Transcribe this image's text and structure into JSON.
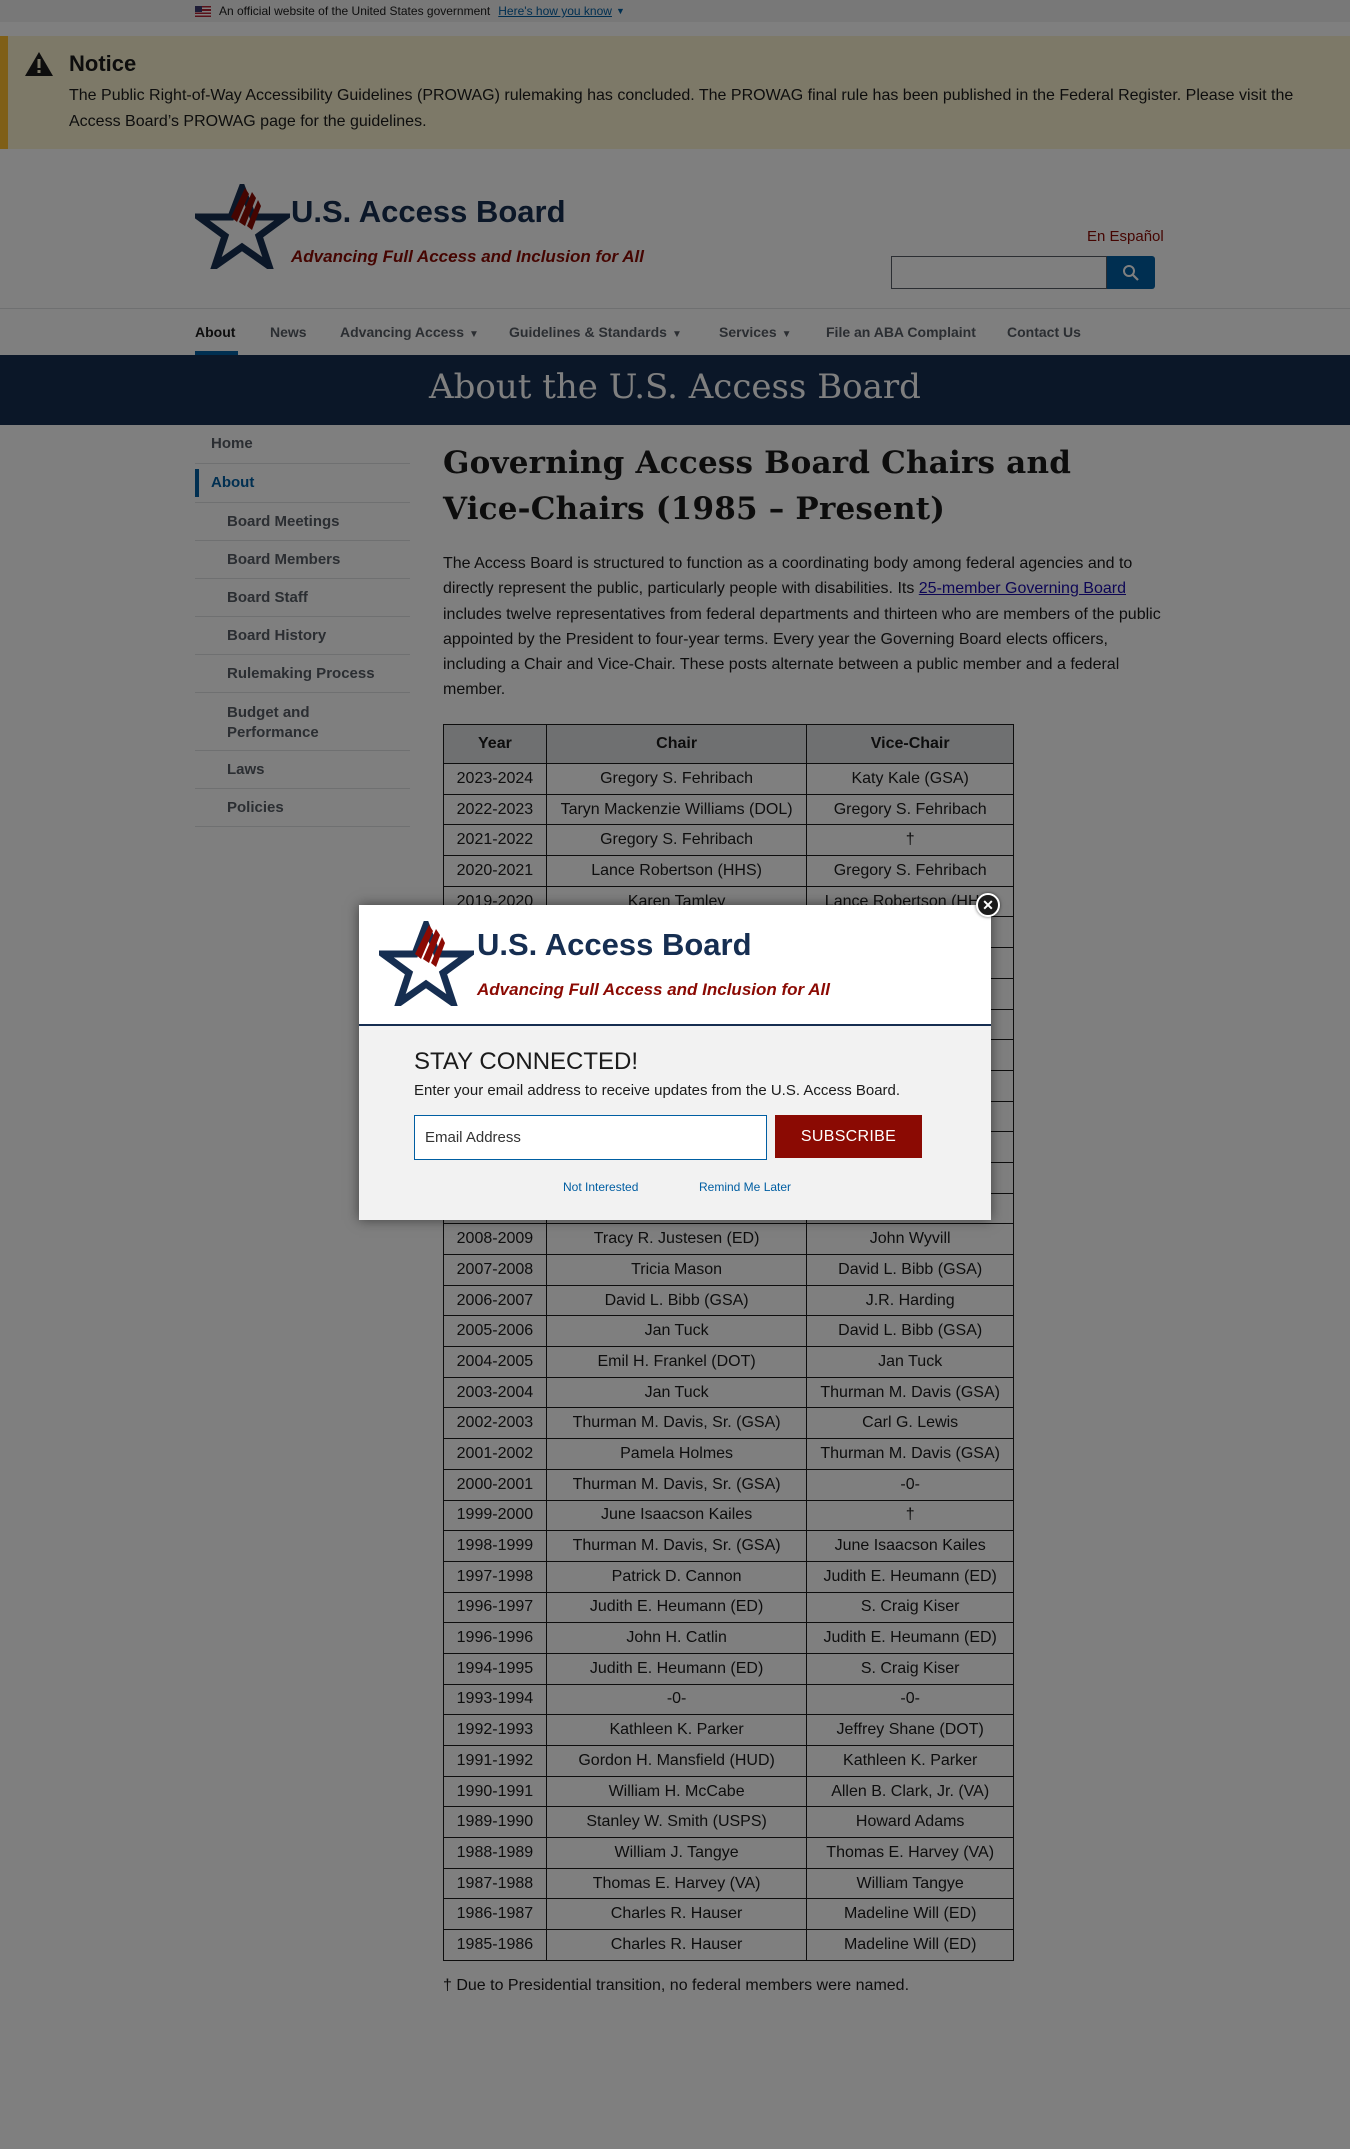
{
  "gov_banner": {
    "text": "An official website of the United States government",
    "link": "Here's how you know"
  },
  "notice": {
    "title": "Notice",
    "body": "The Public Right-of-Way Accessibility Guidelines (PROWAG) rulemaking has concluded. The PROWAG final rule has been published in the Federal Register. Please visit the Access Board’s PROWAG page for the guidelines."
  },
  "header": {
    "site_title": "U.S. Access Board",
    "tagline": "Advancing Full Access and Inclusion for All",
    "language_link": "En Español",
    "search_value": ""
  },
  "nav": {
    "items": [
      {
        "label": "About",
        "active": true
      },
      {
        "label": "News"
      },
      {
        "label": "Advancing Access",
        "dropdown": true
      },
      {
        "label": "Guidelines & Standards",
        "dropdown": true
      },
      {
        "label": "Services",
        "dropdown": true
      },
      {
        "label": "File an ABA Complaint"
      },
      {
        "label": "Contact Us"
      }
    ]
  },
  "hero": {
    "title": "About the U.S. Access Board"
  },
  "sidebar": {
    "items": [
      {
        "label": "Home"
      },
      {
        "label": "About",
        "current": true
      },
      {
        "label": "Board Meetings"
      },
      {
        "label": "Board Members"
      },
      {
        "label": "Board Staff"
      },
      {
        "label": "Board History"
      },
      {
        "label": "Rulemaking Process"
      },
      {
        "label": "Budget and Performance"
      },
      {
        "label": "Laws"
      },
      {
        "label": "Policies"
      }
    ]
  },
  "main": {
    "heading": "Governing Access Board Chairs and Vice-Chairs (1985 – Present)",
    "intro_before": "The Access Board is structured to function as a coordinating body among federal agencies and to directly represent the public, particularly people with disabilities. Its ",
    "intro_link": "25-member Governing Board",
    "intro_after": " includes twelve representatives from federal departments and thirteen who are members of the public appointed by the President to four-year terms. Every year the Governing Board elects officers, including a Chair and Vice-Chair. These posts alternate between a public member and a federal member.",
    "table": {
      "headers": [
        "Year",
        "Chair",
        "Vice-Chair"
      ],
      "rows": [
        [
          "2023-2024",
          "Gregory S. Fehribach",
          "Katy Kale (GSA)"
        ],
        [
          "2022-2023",
          "Taryn Mackenzie Williams (DOL)",
          "Gregory S. Fehribach"
        ],
        [
          "2021-2022",
          "Gregory S. Fehribach",
          "†"
        ],
        [
          "2020-2021",
          "Lance Robertson (HHS)",
          "Gregory S. Fehribach"
        ],
        [
          "2019-2020",
          "Karen Tamley",
          "Lance Robertson (HHS)"
        ],
        [
          "",
          "",
          ""
        ],
        [
          "",
          "",
          ""
        ],
        [
          "",
          "",
          ""
        ],
        [
          "",
          "",
          ""
        ],
        [
          "",
          "",
          ""
        ],
        [
          "",
          "",
          ""
        ],
        [
          "",
          "",
          ""
        ],
        [
          "",
          "",
          ""
        ],
        [
          "",
          "",
          ""
        ],
        [
          "",
          "",
          ""
        ],
        [
          "2008-2009",
          "Tracy R. Justesen (ED)",
          "John Wyvill"
        ],
        [
          "2007-2008",
          "Tricia Mason",
          "David L. Bibb (GSA)"
        ],
        [
          "2006-2007",
          "David L. Bibb (GSA)",
          "J.R. Harding"
        ],
        [
          "2005-2006",
          "Jan Tuck",
          "David L. Bibb (GSA)"
        ],
        [
          "2004-2005",
          "Emil H. Frankel (DOT)",
          "Jan Tuck"
        ],
        [
          "2003-2004",
          "Jan Tuck",
          "Thurman M. Davis (GSA)"
        ],
        [
          "2002-2003",
          "Thurman M. Davis, Sr. (GSA)",
          "Carl G. Lewis"
        ],
        [
          "2001-2002",
          "Pamela Holmes",
          "Thurman M. Davis (GSA)"
        ],
        [
          "2000-2001",
          "Thurman M. Davis, Sr. (GSA)",
          "-0-"
        ],
        [
          "1999-2000",
          "June Isaacson Kailes",
          "†"
        ],
        [
          "1998-1999",
          "Thurman M. Davis, Sr. (GSA)",
          "June Isaacson Kailes"
        ],
        [
          "1997-1998",
          "Patrick D. Cannon",
          "Judith E. Heumann (ED)"
        ],
        [
          "1996-1997",
          "Judith E. Heumann (ED)",
          "S. Craig Kiser"
        ],
        [
          "1996-1996",
          "John H. Catlin",
          "Judith E. Heumann (ED)"
        ],
        [
          "1994-1995",
          "Judith E. Heumann (ED)",
          "S. Craig Kiser"
        ],
        [
          "1993-1994",
          "-0-",
          "-0-"
        ],
        [
          "1992-1993",
          "Kathleen K. Parker",
          "Jeffrey Shane (DOT)"
        ],
        [
          "1991-1992",
          "Gordon H. Mansfield (HUD)",
          "Kathleen K. Parker"
        ],
        [
          "1990-1991",
          "William H. McCabe",
          "Allen B. Clark, Jr. (VA)"
        ],
        [
          "1989-1990",
          "Stanley W. Smith (USPS)",
          "Howard Adams"
        ],
        [
          "1988-1989",
          "William J. Tangye",
          "Thomas E. Harvey (VA)"
        ],
        [
          "1987-1988",
          "Thomas E. Harvey (VA)",
          "William Tangye"
        ],
        [
          "1986-1987",
          "Charles R. Hauser",
          "Madeline Will (ED)"
        ],
        [
          "1985-1986",
          "Charles R. Hauser",
          "Madeline Will (ED)"
        ]
      ]
    },
    "footnote": "† Due to Presidential transition, no federal members were named."
  },
  "modal": {
    "site_title": "U.S. Access Board",
    "tagline": "Advancing Full Access and Inclusion for All",
    "heading": "STAY CONNECTED!",
    "subtext": "Enter your email address to receive updates from the U.S. Access Board.",
    "email_placeholder": "Email Address",
    "subscribe_label": "SUBSCRIBE",
    "not_interested": "Not Interested",
    "remind_later": "Remind Me Later"
  },
  "colors": {
    "navy": "#162e51",
    "brand_red": "#8b0a03",
    "link_blue": "#005ea2",
    "notice_bg": "#faf3d1",
    "notice_accent": "#ffbe2e"
  }
}
